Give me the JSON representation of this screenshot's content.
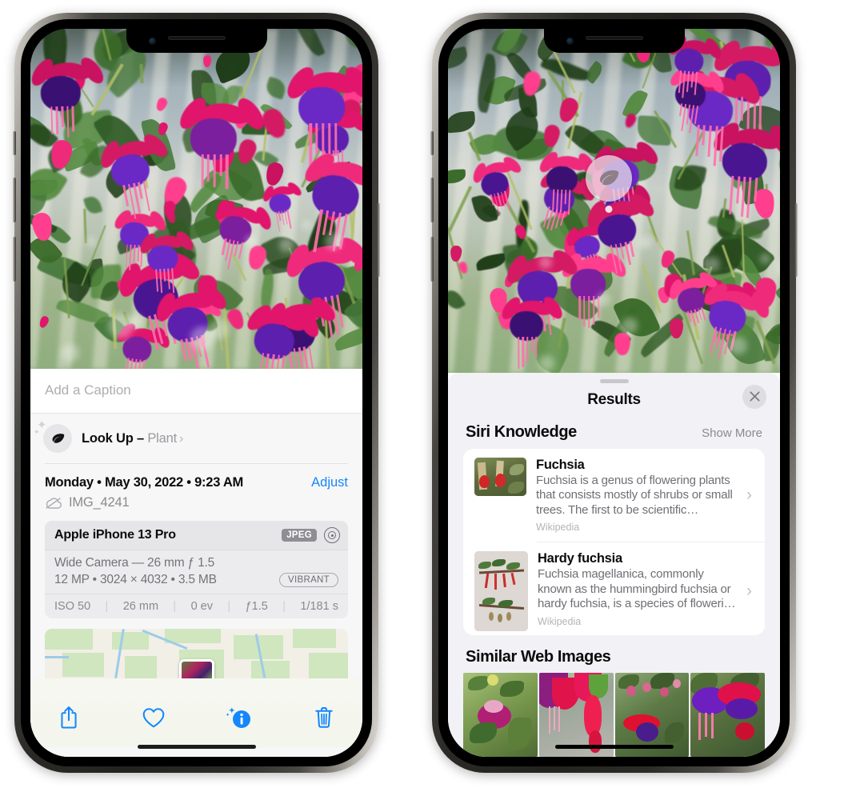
{
  "left_phone": {
    "caption_placeholder": "Add a Caption",
    "lookup": {
      "label": "Look Up – ",
      "subject": "Plant",
      "chevron": "›",
      "icon": "leaf-icon"
    },
    "date_line": "Monday • May 30, 2022 • 9:23 AM",
    "adjust_label": "Adjust",
    "file_name": "IMG_4241",
    "cloud_icon": "icloud-slash-icon",
    "camera_card": {
      "model": "Apple iPhone 13 Pro",
      "format_badge": "JPEG",
      "raw_icon": "raw-capture-icon",
      "lens_line": "Wide Camera — 26 mm ƒ 1.5",
      "spec_line": "12 MP • 3024 × 4032 • 3.5 MB",
      "style_badge": "VIBRANT",
      "exif": [
        "ISO 50",
        "26 mm",
        "0 ev",
        "ƒ1.5",
        "1/181 s"
      ]
    },
    "toolbar": [
      {
        "name": "share-button",
        "icon": "share-icon"
      },
      {
        "name": "favorite-button",
        "icon": "heart-icon"
      },
      {
        "name": "info-button",
        "icon": "info-sparkle-icon"
      },
      {
        "name": "delete-button",
        "icon": "trash-icon"
      }
    ]
  },
  "right_phone": {
    "leaf_badge_icon": "leaf-icon",
    "results_title": "Results",
    "close_label": "✕",
    "siri_knowledge": {
      "title": "Siri Knowledge",
      "show_more": "Show More",
      "items": [
        {
          "title": "Fuchsia",
          "description": "Fuchsia is a genus of flowering plants that consists mostly of shrubs or small trees. The first to be scientific…",
          "source": "Wikipedia",
          "chevron": "›"
        },
        {
          "title": "Hardy fuchsia",
          "description": "Fuchsia magellanica, commonly known as the hummingbird fuchsia or hardy fuchsia, is a species of floweri…",
          "source": "Wikipedia",
          "chevron": "›"
        }
      ]
    },
    "similar_web_images": {
      "title": "Similar Web Images",
      "thumbnails": [
        "sim-image-1",
        "sim-image-2",
        "sim-image-3",
        "sim-image-4"
      ]
    }
  },
  "colors": {
    "ios_blue": "#1487fb",
    "sheet_bg": "#f7f7f7",
    "results_bg": "#f2f1f6",
    "card_bg": "#ffffff",
    "muted_text": "#8a8a8f"
  }
}
